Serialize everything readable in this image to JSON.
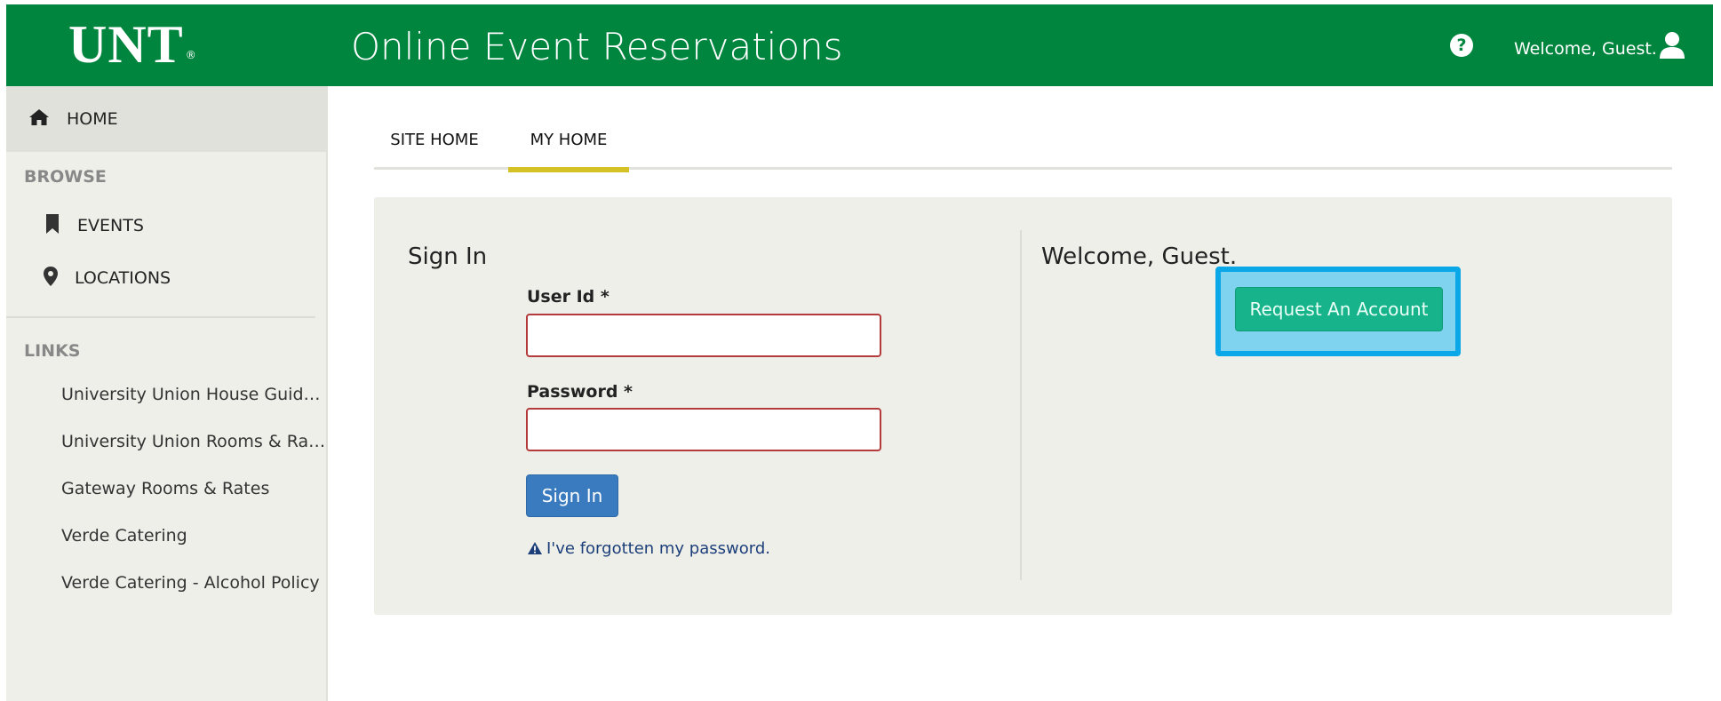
{
  "header": {
    "logo": "UNT",
    "logo_mark": "®",
    "title": "Online Event Reservations",
    "welcome": "Welcome, Guest.",
    "help_icon": "question-circle-icon",
    "user_icon": "user-icon",
    "background_color": "#00853e"
  },
  "sidebar": {
    "home_label": "HOME",
    "browse_heading": "BROWSE",
    "browse_items": [
      {
        "label": "EVENTS",
        "icon": "bookmark-icon"
      },
      {
        "label": "LOCATIONS",
        "icon": "map-marker-icon"
      }
    ],
    "links_heading": "LINKS",
    "links": [
      "University Union House Guideli...",
      "University Union Rooms & Rates",
      "Gateway Rooms & Rates",
      "Verde Catering",
      "Verde Catering - Alcohol Policy"
    ]
  },
  "tabs": [
    {
      "label": "SITE HOME",
      "active": false
    },
    {
      "label": "MY HOME",
      "active": true
    }
  ],
  "signin": {
    "title": "Sign In",
    "user_id_label": "User Id *",
    "user_id_value": "",
    "password_label": "Password *",
    "password_value": "",
    "button_label": "Sign In",
    "forgot_label": "I've forgotten my password."
  },
  "welcome_panel": {
    "title": "Welcome, Guest.",
    "request_button_label": "Request An Account"
  },
  "colors": {
    "accent_green": "#00853e",
    "tab_underline": "#d4c125",
    "primary_button": "#3a7bbf",
    "request_button": "#17b38a",
    "highlight": "#0aa8e8"
  }
}
